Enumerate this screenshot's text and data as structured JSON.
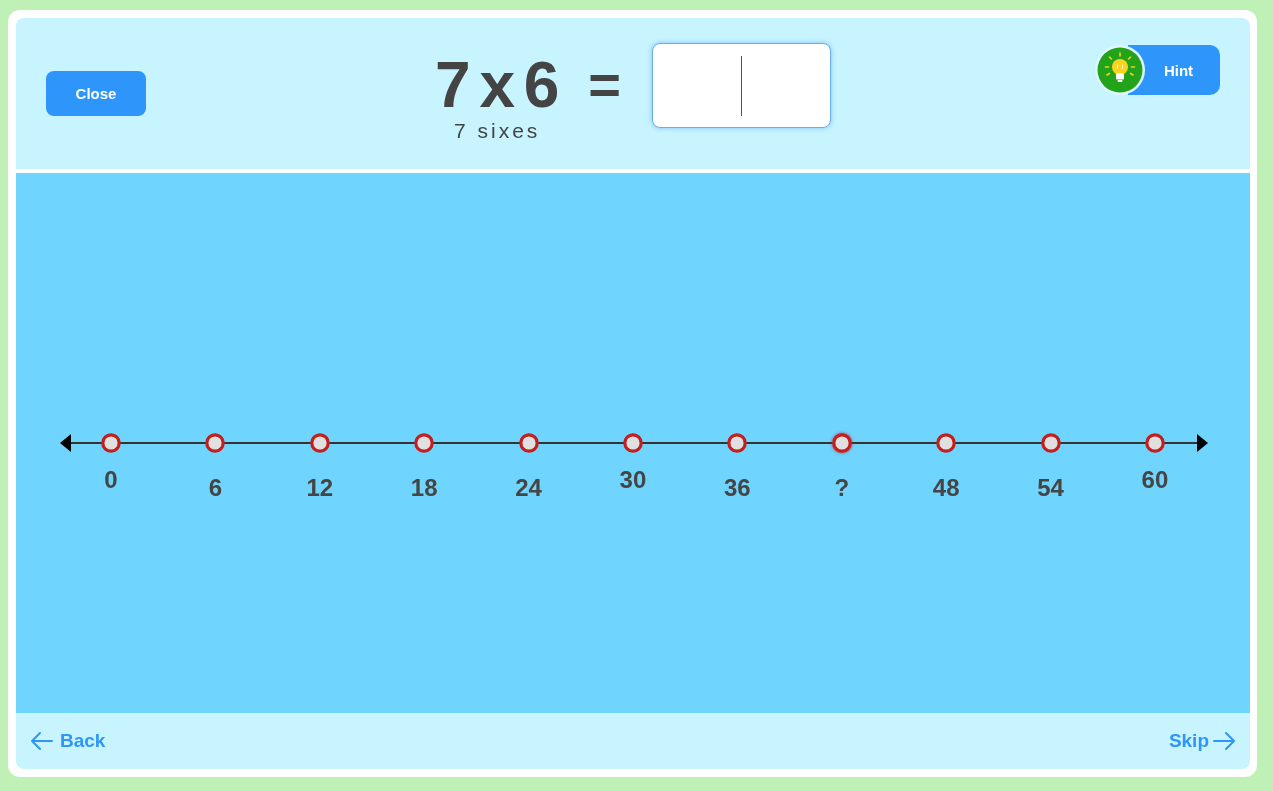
{
  "header": {
    "close_button": "Close",
    "equation": {
      "expression": "7 x 6",
      "equals": "=",
      "hint": "7 sixes"
    },
    "answer_field": {
      "focused": true
    },
    "hint_button": "Hint"
  },
  "number_line": {
    "points": [
      {
        "label": "0",
        "target": false
      },
      {
        "label": "6",
        "target": false
      },
      {
        "label": "12",
        "target": false
      },
      {
        "label": "18",
        "target": false
      },
      {
        "label": "24",
        "target": false
      },
      {
        "label": "30",
        "target": false
      },
      {
        "label": "36",
        "target": false
      },
      {
        "label": "?",
        "target": true
      },
      {
        "label": "48",
        "target": false
      },
      {
        "label": "54",
        "target": false
      },
      {
        "label": "60",
        "target": false
      }
    ]
  },
  "footer": {
    "back_link": "Back",
    "skip_link": "Skip"
  }
}
